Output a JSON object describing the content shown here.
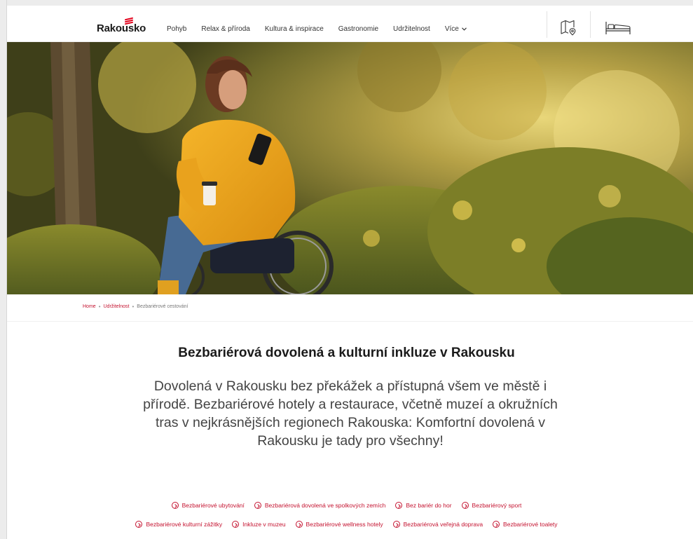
{
  "header": {
    "logo_text": "Rakousko",
    "nav": [
      "Pohyb",
      "Relax & příroda",
      "Kultura & inspirace",
      "Gastronomie",
      "Udržitelnost"
    ],
    "more_label": "Více",
    "map_icon": "map-pin-icon",
    "bed_icon": "bed-icon",
    "brand_color": "#e3001b"
  },
  "hero": {
    "image": "woman-in-wheelchair-park-photo"
  },
  "breadcrumb": {
    "home": "Home",
    "section": "Udržitelnost",
    "current": "Bezbariérové cestování"
  },
  "main": {
    "title": "Bezbariérová dovolená a kulturní inkluze v Rakousku",
    "intro": "Dovolená v Rakousku bez překážek a přístupná všem ve městě i přírodě. Bezbariérové hotely a restaurace, včetně muzeí a okružních tras v nejkrásnějších regionech Rakouska: Komfortní dovolená v Rakousku je tady pro všechny!"
  },
  "tags": {
    "row1": [
      "Bezbariérové ubytování",
      "Bezbariérová dovolená ve spolkových zemích",
      "Bez bariér do hor",
      "Bezbariérový sport"
    ],
    "row2": [
      "Bezbariérové kulturní zážitky",
      "Inkluze v muzeu",
      "Bezbariérové wellness hotely",
      "Bezbariérová veřejná doprava",
      "Bezbariérové toalety"
    ],
    "accent_color": "#c4122f"
  }
}
